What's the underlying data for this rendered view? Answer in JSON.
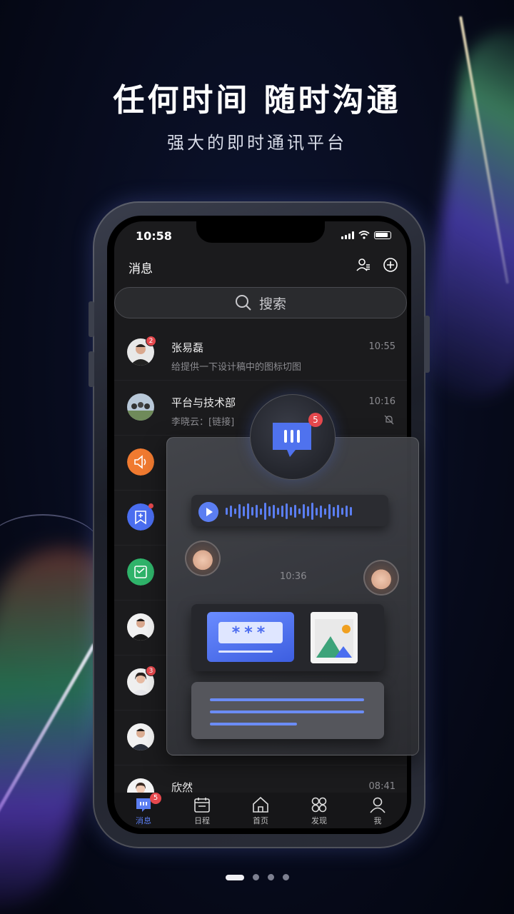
{
  "headline": "任何时间 随时沟通",
  "subline": "强大的即时通讯平台",
  "status": {
    "time": "10:58"
  },
  "app": {
    "title": "消息"
  },
  "search": {
    "placeholder": "搜索"
  },
  "conversations": [
    {
      "name": "张易磊",
      "preview": "给提供一下设计稿中的图标切图",
      "time": "10:55",
      "badge": "2",
      "avatar": "person-avatar"
    },
    {
      "name": "平台与技术部",
      "preview": "李晓云：[链接]",
      "time": "10:16",
      "muted": true,
      "avatar": "group-avatar"
    },
    {
      "avatar": "speaker-icon",
      "color": "#f07a30"
    },
    {
      "avatar": "add-bookmark-icon",
      "color": "#4a6ef0",
      "dot": true
    },
    {
      "avatar": "calendar-check-icon",
      "color": "#2fb36a"
    },
    {
      "avatar": "person-avatar"
    },
    {
      "badge": "3",
      "avatar": "person-avatar"
    },
    {
      "avatar": "person-avatar"
    },
    {
      "name": "欣然",
      "time": "08:41",
      "avatar": "person-avatar"
    }
  ],
  "floating": {
    "bubble_badge": "5",
    "chat_time": "10:36",
    "password_mask": "***"
  },
  "tabs": [
    {
      "label": "消息",
      "icon": "chat-icon",
      "badge": "5",
      "active": true
    },
    {
      "label": "日程",
      "icon": "calendar-icon"
    },
    {
      "label": "首页",
      "icon": "home-icon"
    },
    {
      "label": "发现",
      "icon": "discover-icon"
    },
    {
      "label": "我",
      "icon": "profile-icon"
    }
  ],
  "pager": {
    "count": 4,
    "active_index": 0
  },
  "colors": {
    "accent": "#5b7ef2",
    "badge": "#e5484d",
    "background": "#070b1c"
  }
}
